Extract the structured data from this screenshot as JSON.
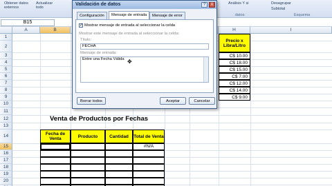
{
  "ribbon": {
    "external_data": "Obtener datos\nexternos",
    "refresh": "Actualizar\ntodo",
    "filter_hint": "Filtro",
    "advanced_hint": "Avanzadas",
    "data_tools": "datos",
    "whatif": "Análisis Y si",
    "ungroup": "Desagrupar",
    "subtotal": "Subtotal",
    "outline_group": "Esquema"
  },
  "namebox": "B15",
  "columns": [
    "A",
    "B",
    "C",
    "D",
    "E",
    "F",
    "G",
    "H",
    "I"
  ],
  "rows": [
    "1",
    "2",
    "3",
    "4",
    "5",
    "6",
    "7",
    "8",
    "9",
    "10",
    "11",
    "12",
    "13",
    "14",
    "15",
    "16",
    "17",
    "18",
    "19",
    "20",
    "21"
  ],
  "price_header": "Precio x Libra/Litro",
  "prices": [
    "C$ 10.00",
    "C$ 18.00",
    "C$ 15.00",
    "C$ 7.00",
    "C$ 12.00",
    "C$ 14.00",
    "C$ 9.00"
  ],
  "sales_title": "Venta de Productos por Fechas",
  "sales_headers": [
    "Fecha de Venta",
    "Producto",
    "Cantidad",
    "Total de Venta"
  ],
  "total_value": "#N/A",
  "dialog": {
    "title": "Validación de datos",
    "help": "?",
    "close": "X",
    "tabs": [
      "Configuración",
      "Mensaje de entrada",
      "Mensaje de error"
    ],
    "show_checkbox_label": "Mostrar mensaje de entrada al seleccionar la celda",
    "section_label": "Mostrar este mensaje de entrada al seleccionar la celda:",
    "title_label": "Título:",
    "title_value": "FECHA",
    "message_label": "Mensaje de entrada:",
    "message_value": "Entre una Fecha Válida",
    "clear_all": "Borrar todos",
    "ok": "Aceptar",
    "cancel": "Cancelar"
  }
}
